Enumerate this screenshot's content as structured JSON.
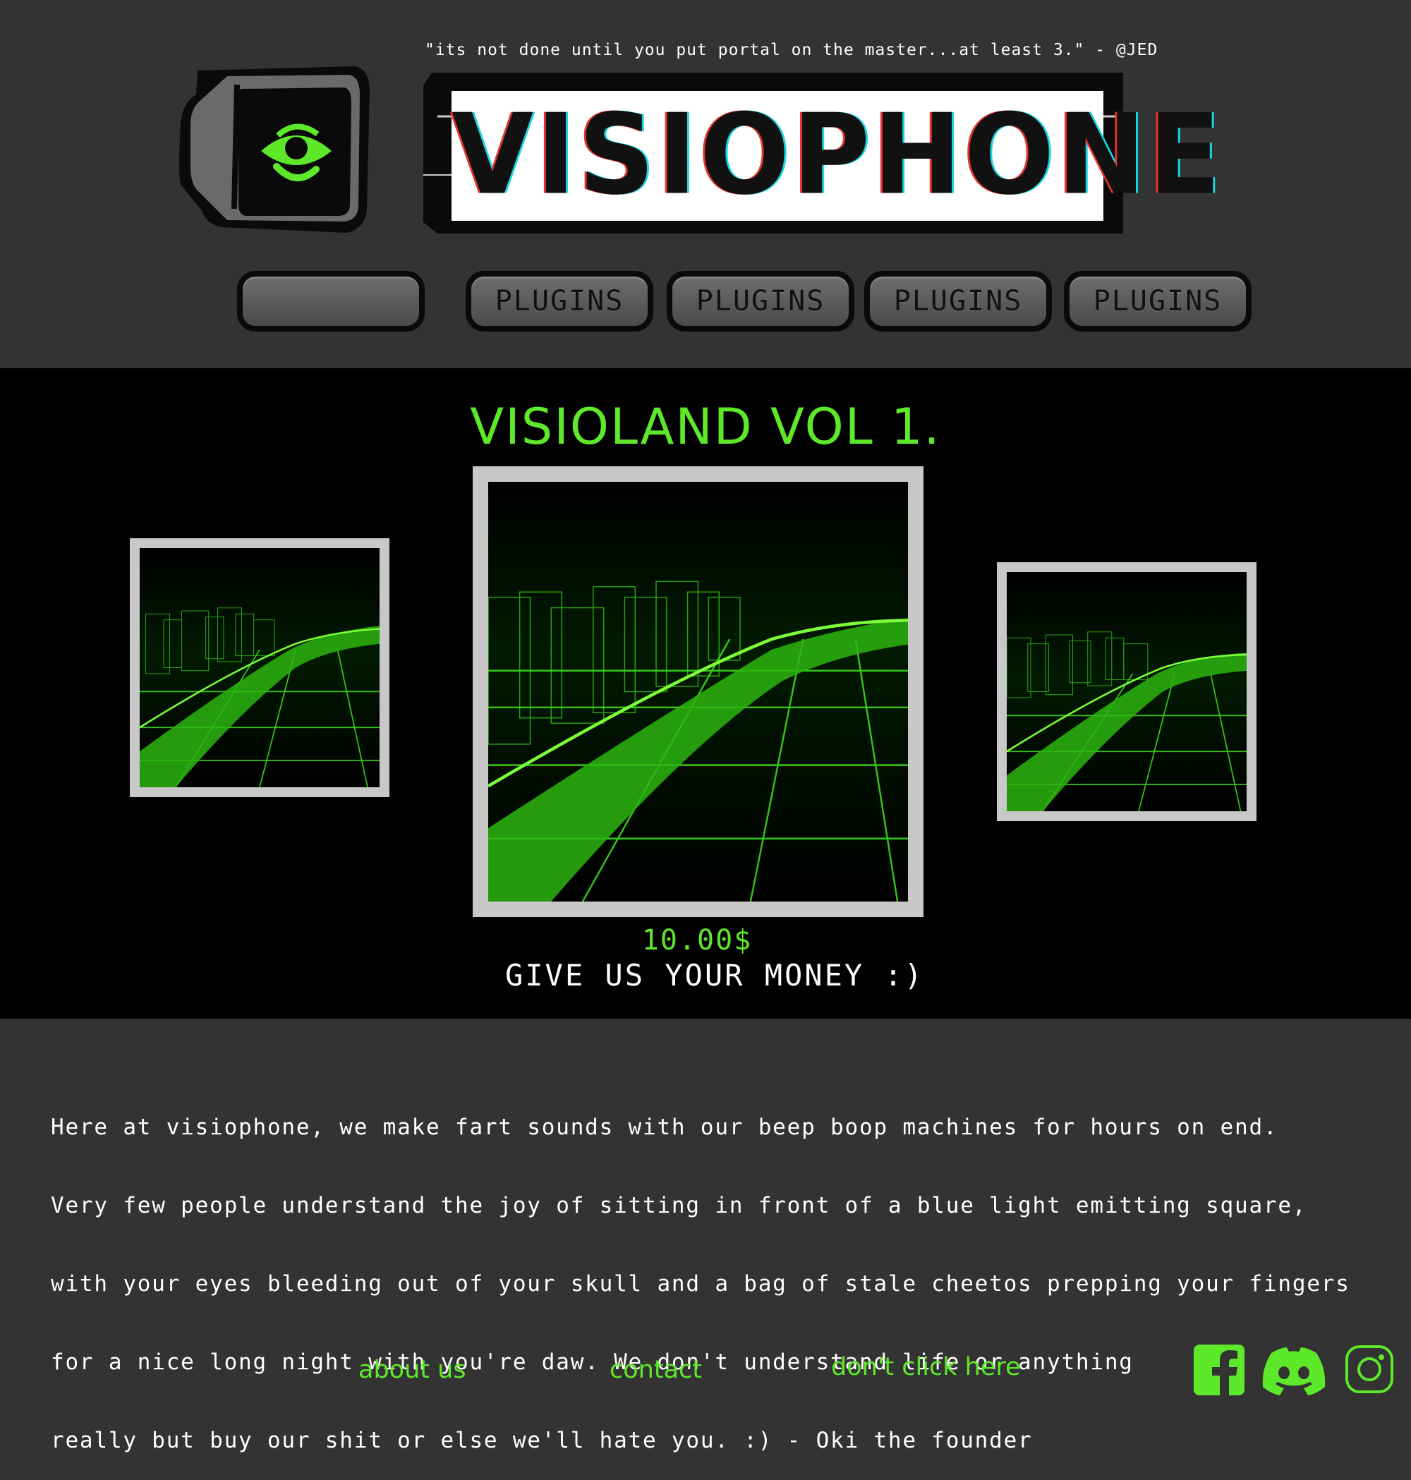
{
  "header": {
    "quote": "\"its not done until you put portal on the master...at least 3.\" - @JED",
    "brand": "VISIOPHONE",
    "logo_icon": "tv-eye-icon"
  },
  "nav": {
    "search_value": "",
    "items": [
      "PLUGINS",
      "PLUGINS",
      "PLUGINS",
      "PLUGINS"
    ]
  },
  "feature": {
    "title": "VISIOLAND VOL 1.",
    "price": "10.00$",
    "cta": "GIVE US YOUR MONEY :)"
  },
  "about": {
    "lines": [
      "Here at visiophone, we make fart sounds with our beep boop machines for hours on end.",
      "Very few people understand the joy of sitting in front of a blue light emitting square,",
      "with your eyes bleeding out of your skull and a bag of stale cheetos prepping your fingers",
      "for a nice long night with you're daw. We don't understand life or anything",
      "really but buy our shit or else we'll hate you. :) - Oki the founder"
    ]
  },
  "footer": {
    "links": [
      "about us",
      "contact",
      "don't click here"
    ],
    "social": [
      "facebook-icon",
      "discord-icon",
      "instagram-icon"
    ]
  },
  "colors": {
    "background": "#333333",
    "accent_green": "#5ee82a",
    "feature_bg": "#000000",
    "frame": "#c8c8c8"
  }
}
